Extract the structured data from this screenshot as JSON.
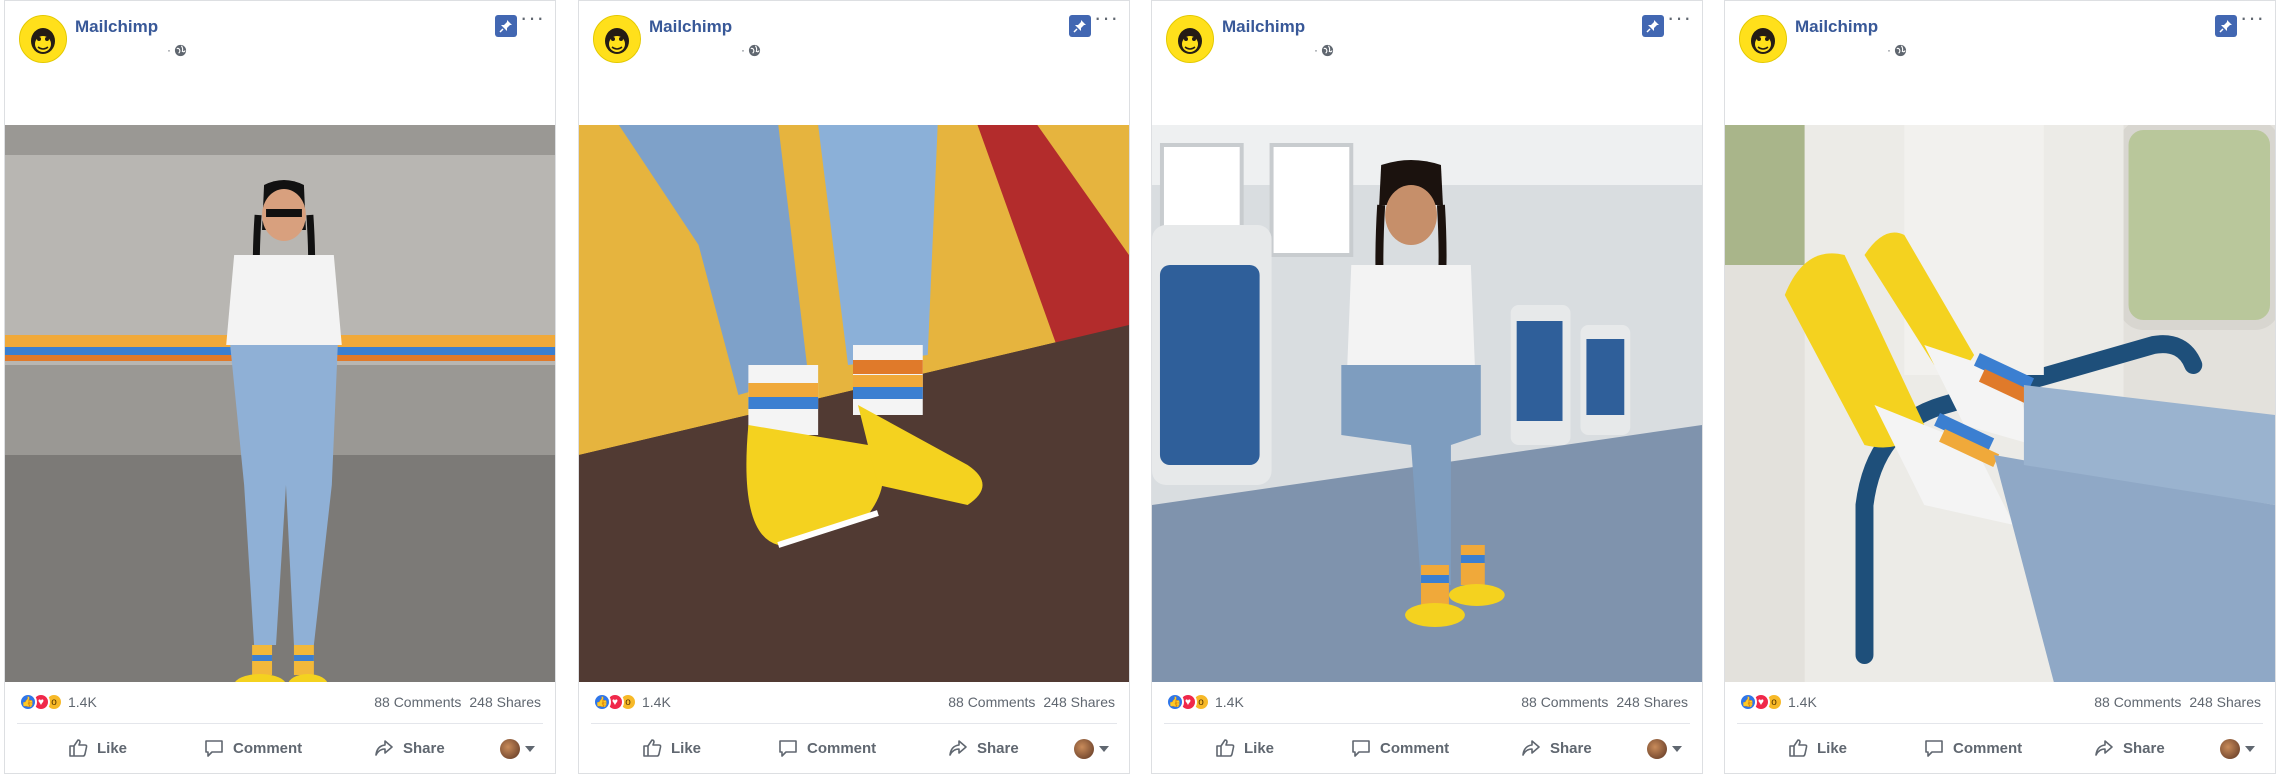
{
  "posts": [
    {
      "page_name": "Mailchimp",
      "meta_dot": "·",
      "reaction_count": "1.4K",
      "comments": "88 Comments",
      "shares": "248 Shares",
      "actions": {
        "like": "Like",
        "comment": "Comment",
        "share": "Share"
      },
      "photo": "Woman with long braids, sunglasses, white tee and jeans wearing striped socks and yellow slip-on sneakers on a subway platform with a moving train"
    },
    {
      "page_name": "Mailchimp",
      "meta_dot": "·",
      "reaction_count": "1.4K",
      "comments": "88 Comments",
      "shares": "248 Shares",
      "actions": {
        "like": "Like",
        "comment": "Comment",
        "share": "Share"
      },
      "photo": "Close-up of crossed legs in jeans with rainbow striped socks and yellow slip-on sneakers against a yellow and red tiled wall"
    },
    {
      "page_name": "Mailchimp",
      "meta_dot": "·",
      "reaction_count": "1.4K",
      "comments": "88 Comments",
      "shares": "248 Shares",
      "actions": {
        "like": "Like",
        "comment": "Comment",
        "share": "Share"
      },
      "photo": "Woman sitting on a subway train seat wearing striped socks and yellow sneakers"
    },
    {
      "page_name": "Mailchimp",
      "meta_dot": "·",
      "reaction_count": "1.4K",
      "comments": "88 Comments",
      "shares": "248 Shares",
      "actions": {
        "like": "Like",
        "comment": "Comment",
        "share": "Share"
      },
      "photo": "Feet in yellow slip-on sneakers and striped socks resting on a train seat rail"
    }
  ],
  "colors": {
    "brand_link": "#385898",
    "pin_badge": "#4267b2",
    "like": "#2f76e9",
    "love": "#f0284a",
    "wow": "#f7b928",
    "mailchimp_yellow": "#ffe01b"
  },
  "icons": [
    "mailchimp-logo-icon",
    "globe-icon",
    "pin-icon",
    "more-icon",
    "like-reaction-icon",
    "love-reaction-icon",
    "wow-reaction-icon",
    "thumbs-up-icon",
    "comment-icon",
    "share-icon",
    "caret-down-icon"
  ]
}
